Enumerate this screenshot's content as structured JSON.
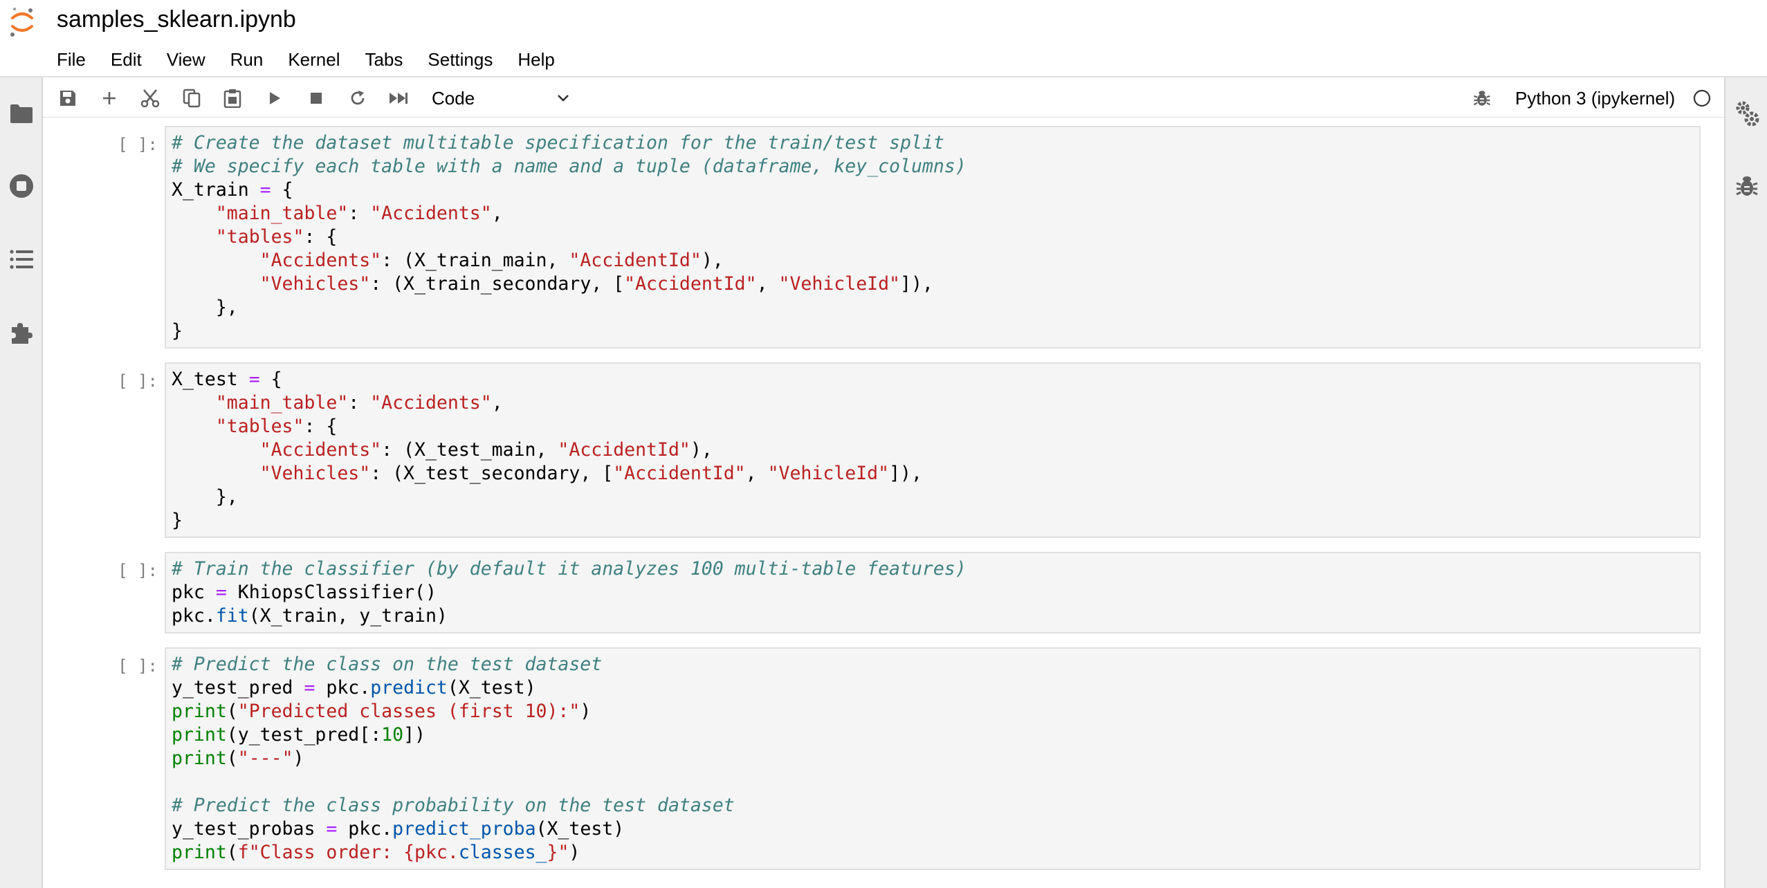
{
  "app": {
    "document_title": "samples_sklearn.ipynb"
  },
  "menu": [
    "File",
    "Edit",
    "View",
    "Run",
    "Kernel",
    "Tabs",
    "Settings",
    "Help"
  ],
  "toolbar": {
    "cell_type": "Code",
    "kernel": "Python 3 (ipykernel)"
  },
  "colors": {
    "comment": "#408080",
    "string": "#ba2121",
    "operator": "#aa22ff",
    "builtin": "#008000",
    "method": "#0055aa",
    "logo": "#f37726"
  },
  "cells": [
    {
      "prompt": "[ ]:",
      "lines": [
        [
          {
            "t": "# Create the dataset multitable specification for the train/test split",
            "c": "cm"
          }
        ],
        [
          {
            "t": "# We specify each table with a name and a tuple (dataframe, key_columns)",
            "c": "cm"
          }
        ],
        [
          {
            "t": "X_train "
          },
          {
            "t": "=",
            "c": "op"
          },
          {
            "t": " {"
          }
        ],
        [
          {
            "t": "    "
          },
          {
            "t": "\"main_table\"",
            "c": "st"
          },
          {
            "t": ": "
          },
          {
            "t": "\"Accidents\"",
            "c": "st"
          },
          {
            "t": ","
          }
        ],
        [
          {
            "t": "    "
          },
          {
            "t": "\"tables\"",
            "c": "st"
          },
          {
            "t": ": {"
          }
        ],
        [
          {
            "t": "        "
          },
          {
            "t": "\"Accidents\"",
            "c": "st"
          },
          {
            "t": ": (X_train_main, "
          },
          {
            "t": "\"AccidentId\"",
            "c": "st"
          },
          {
            "t": "),"
          }
        ],
        [
          {
            "t": "        "
          },
          {
            "t": "\"Vehicles\"",
            "c": "st"
          },
          {
            "t": ": (X_train_secondary, ["
          },
          {
            "t": "\"AccidentId\"",
            "c": "st"
          },
          {
            "t": ", "
          },
          {
            "t": "\"VehicleId\"",
            "c": "st"
          },
          {
            "t": "]),"
          }
        ],
        [
          {
            "t": "    },"
          }
        ],
        [
          {
            "t": "}"
          }
        ]
      ]
    },
    {
      "prompt": "[ ]:",
      "lines": [
        [
          {
            "t": "X_test "
          },
          {
            "t": "=",
            "c": "op"
          },
          {
            "t": " {"
          }
        ],
        [
          {
            "t": "    "
          },
          {
            "t": "\"main_table\"",
            "c": "st"
          },
          {
            "t": ": "
          },
          {
            "t": "\"Accidents\"",
            "c": "st"
          },
          {
            "t": ","
          }
        ],
        [
          {
            "t": "    "
          },
          {
            "t": "\"tables\"",
            "c": "st"
          },
          {
            "t": ": {"
          }
        ],
        [
          {
            "t": "        "
          },
          {
            "t": "\"Accidents\"",
            "c": "st"
          },
          {
            "t": ": (X_test_main, "
          },
          {
            "t": "\"AccidentId\"",
            "c": "st"
          },
          {
            "t": "),"
          }
        ],
        [
          {
            "t": "        "
          },
          {
            "t": "\"Vehicles\"",
            "c": "st"
          },
          {
            "t": ": (X_test_secondary, ["
          },
          {
            "t": "\"AccidentId\"",
            "c": "st"
          },
          {
            "t": ", "
          },
          {
            "t": "\"VehicleId\"",
            "c": "st"
          },
          {
            "t": "]),"
          }
        ],
        [
          {
            "t": "    },"
          }
        ],
        [
          {
            "t": "}"
          }
        ]
      ]
    },
    {
      "prompt": "[ ]:",
      "lines": [
        [
          {
            "t": "# Train the classifier (by default it analyzes 100 multi-table features)",
            "c": "cm"
          }
        ],
        [
          {
            "t": "pkc "
          },
          {
            "t": "=",
            "c": "op"
          },
          {
            "t": " KhiopsClassifier()"
          }
        ],
        [
          {
            "t": "pkc."
          },
          {
            "t": "fit",
            "c": "fn"
          },
          {
            "t": "(X_train, y_train)"
          }
        ]
      ]
    },
    {
      "prompt": "[ ]:",
      "lines": [
        [
          {
            "t": "# Predict the class on the test dataset",
            "c": "cm"
          }
        ],
        [
          {
            "t": "y_test_pred "
          },
          {
            "t": "=",
            "c": "op"
          },
          {
            "t": " pkc."
          },
          {
            "t": "predict",
            "c": "fn"
          },
          {
            "t": "(X_test)"
          }
        ],
        [
          {
            "t": "print",
            "c": "bi"
          },
          {
            "t": "("
          },
          {
            "t": "\"Predicted classes (first 10):\"",
            "c": "st"
          },
          {
            "t": ")"
          }
        ],
        [
          {
            "t": "print",
            "c": "bi"
          },
          {
            "t": "(y_test_pred[:"
          },
          {
            "t": "10",
            "c": "nu"
          },
          {
            "t": "])"
          }
        ],
        [
          {
            "t": "print",
            "c": "bi"
          },
          {
            "t": "("
          },
          {
            "t": "\"---\"",
            "c": "st"
          },
          {
            "t": ")"
          }
        ],
        [
          {
            "t": ""
          }
        ],
        [
          {
            "t": "# Predict the class probability on the test dataset",
            "c": "cm"
          }
        ],
        [
          {
            "t": "y_test_probas "
          },
          {
            "t": "=",
            "c": "op"
          },
          {
            "t": " pkc."
          },
          {
            "t": "predict_proba",
            "c": "fn"
          },
          {
            "t": "(X_test)"
          }
        ],
        [
          {
            "t": "print",
            "c": "bi"
          },
          {
            "t": "("
          },
          {
            "t": "f\"Class order: {pkc.",
            "c": "st"
          },
          {
            "t": "classes_",
            "c": "fn"
          },
          {
            "t": "}\"",
            "c": "st"
          },
          {
            "t": ")"
          }
        ]
      ]
    }
  ]
}
